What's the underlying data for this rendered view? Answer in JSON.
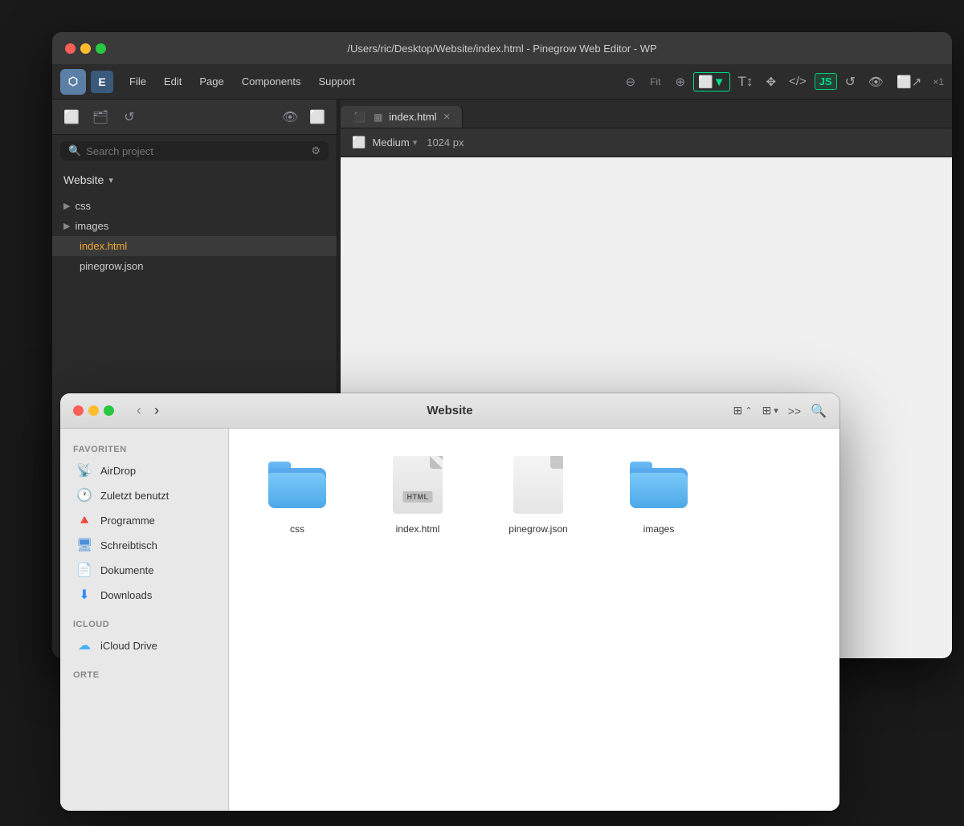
{
  "window": {
    "title": "/Users/ric/Desktop/Website/index.html - Pinegrow Web Editor - WP",
    "traffic_lights": [
      "close",
      "minimize",
      "maximize"
    ]
  },
  "toolbar": {
    "menu_items": [
      "File",
      "Edit",
      "Page",
      "Components",
      "Support"
    ],
    "fit_label": "Fit",
    "scale_label": "×1"
  },
  "sidebar": {
    "search_placeholder": "Search project",
    "project_name": "Website",
    "files": [
      {
        "name": "css",
        "type": "folder",
        "indent": 0
      },
      {
        "name": "images",
        "type": "folder",
        "indent": 0
      },
      {
        "name": "index.html",
        "type": "file",
        "active": true
      },
      {
        "name": "pinegrow.json",
        "type": "file"
      }
    ]
  },
  "editor": {
    "tab_label": "index.html",
    "viewport_label": "Medium",
    "viewport_px": "1024 px"
  },
  "finder": {
    "title": "Website",
    "sidebar_sections": [
      {
        "header": "Favoriten",
        "items": [
          {
            "label": "AirDrop",
            "icon": "airdrop"
          },
          {
            "label": "Zuletzt benutzt",
            "icon": "recent"
          },
          {
            "label": "Programme",
            "icon": "apps"
          },
          {
            "label": "Schreibtisch",
            "icon": "desktop"
          },
          {
            "label": "Dokumente",
            "icon": "docs"
          },
          {
            "label": "Downloads",
            "icon": "downloads"
          }
        ]
      },
      {
        "header": "iCloud",
        "items": [
          {
            "label": "iCloud Drive",
            "icon": "icloud"
          }
        ]
      },
      {
        "header": "Orte",
        "items": []
      }
    ],
    "files": [
      {
        "name": "css",
        "type": "folder"
      },
      {
        "name": "index.html",
        "type": "html"
      },
      {
        "name": "pinegrow.json",
        "type": "json"
      },
      {
        "name": "images",
        "type": "folder"
      }
    ]
  }
}
